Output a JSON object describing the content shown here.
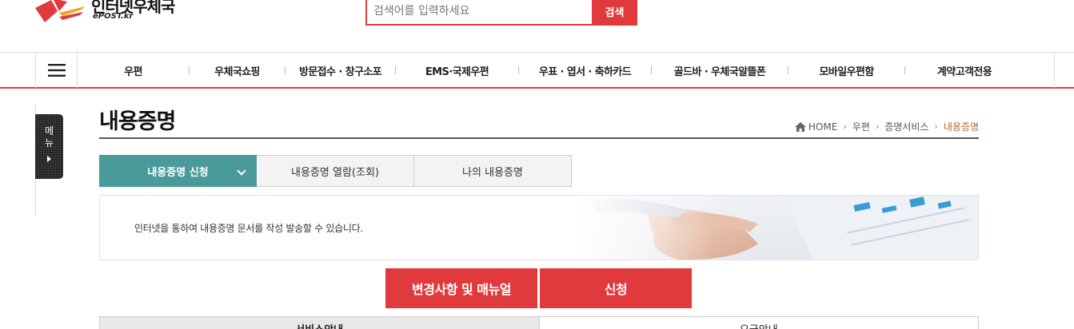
{
  "header": {
    "logo_name": "인터넷우체국",
    "logo_sub": "ePOST.kr",
    "search_placeholder": "검색어를 입력하세요",
    "search_button": "검색"
  },
  "gnb": {
    "items": [
      "우편",
      "우체국쇼핑",
      "방문접수 · 창구소포",
      "EMS·국제우편",
      "우표 · 엽서 · 축하카드",
      "골드바 · 우체국알뜰폰",
      "모바일우편함",
      "계약고객전용"
    ]
  },
  "side_tab": {
    "label": "메뉴"
  },
  "page": {
    "title": "내용증명",
    "breadcrumb": [
      "HOME",
      "우편",
      "증명서비스",
      "내용증명"
    ]
  },
  "tabs": [
    "내용증명 신청",
    "내용증명 열람(조회)",
    "나의 내용증명"
  ],
  "banner": {
    "description": "인터넷을 통하여 내용증명 문서를 작성 발송할 수 있습니다."
  },
  "buttons": {
    "manual": "변경사항 및 매뉴얼",
    "apply": "신청"
  },
  "bottom_tabs": [
    "서비스안내",
    "요금안내"
  ],
  "colors": {
    "accent_red": "#e03a3c",
    "tab_teal": "#4a9a9a",
    "breadcrumb_current": "#b5672f"
  },
  "icons": {
    "menu": "hamburger-icon",
    "home": "home-icon",
    "side_arrow": "arrow-right-icon",
    "tab_caret": "chevron-down-icon"
  }
}
